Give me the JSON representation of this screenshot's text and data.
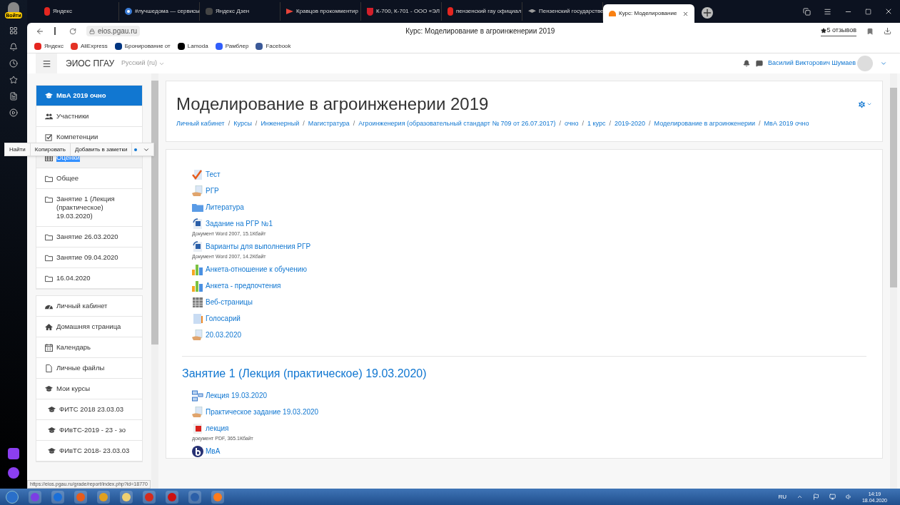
{
  "browser": {
    "login_badge": "Войти",
    "tabs": [
      {
        "title": "Яндекс",
        "selected": false
      },
      {
        "title": "#лучшедома — сервисы",
        "selected": false
      },
      {
        "title": "Яндекс Дзен",
        "selected": false
      },
      {
        "title": "Кравцов прокомментир",
        "selected": false
      },
      {
        "title": "К-700, К-701 - ООО «ЭЛ",
        "selected": false
      },
      {
        "title": "пензенский гау официал",
        "selected": false
      },
      {
        "title": "Пензенский государстве",
        "selected": false
      },
      {
        "title": "Курс: Моделирование",
        "selected": true
      }
    ],
    "address": "eios.pgau.ru",
    "page_title": "Курс: Моделирование в агроинженерии 2019",
    "reviews": "5 отзывов",
    "bookmarks": [
      {
        "label": "Яндекс",
        "color": "#e52620"
      },
      {
        "label": "AliExpress",
        "color": "#e43225"
      },
      {
        "label": "Бронирование от",
        "color": "#003580"
      },
      {
        "label": "Lamoda",
        "color": "#000000"
      },
      {
        "label": "Рамблер",
        "color": "#315efb"
      },
      {
        "label": "Facebook",
        "color": "#3b5998"
      }
    ],
    "status_url": "https://eios.pgau.ru/grade/report/index.php?id=18770"
  },
  "navbar": {
    "site": "ЭИОС ПГАУ",
    "language": "Русский (ru)",
    "user": "Василий Викторович Шумаев"
  },
  "drawer": {
    "groups": [
      {
        "items": [
          {
            "label": "МвА 2019 очно",
            "selected": true,
            "text_selected": false
          },
          {
            "label": "Участники",
            "selected": false,
            "text_selected": false
          },
          {
            "label": "Компетенции",
            "selected": false,
            "text_selected": false
          },
          {
            "label": "Оценки",
            "selected": false,
            "text_selected": true
          },
          {
            "label": "Общее",
            "selected": false,
            "text_selected": false
          },
          {
            "label": "Занятие 1 (Лекция (практическое) 19.03.2020)",
            "selected": false,
            "text_selected": false
          },
          {
            "label": "Занятие 26.03.2020",
            "selected": false,
            "text_selected": false
          },
          {
            "label": "Занятие 09.04.2020",
            "selected": false,
            "text_selected": false
          },
          {
            "label": "16.04.2020",
            "selected": false,
            "text_selected": false
          }
        ]
      },
      {
        "items": [
          {
            "label": "Личный кабинет",
            "selected": false,
            "text_selected": false
          },
          {
            "label": "Домашняя страница",
            "selected": false,
            "text_selected": false
          },
          {
            "label": "Календарь",
            "selected": false,
            "text_selected": false
          },
          {
            "label": "Личные файлы",
            "selected": false,
            "text_selected": false
          },
          {
            "label": "Мои курсы",
            "selected": false,
            "text_selected": false
          },
          {
            "label": "ФИТС 2018 23.03.03",
            "selected": false,
            "text_selected": false
          },
          {
            "label": "ФИвТС-2019 - 23 - зо",
            "selected": false,
            "text_selected": false
          },
          {
            "label": "ФИвТС 2018- 23.03.03",
            "selected": false,
            "text_selected": false
          }
        ]
      }
    ]
  },
  "context_menu": {
    "items": [
      "Найти",
      "Копировать",
      "Добавить в заметки"
    ]
  },
  "course": {
    "title": "Моделирование в агроинженерии 2019",
    "breadcrumbs": [
      {
        "label": "Личный кабинет"
      },
      {
        "separator": "/",
        "label": "Курсы"
      },
      {
        "separator": "/",
        "label": "Инженерный"
      },
      {
        "separator": "/",
        "label": "Магистратура"
      },
      {
        "separator": "/",
        "label": "Агроинженерия (образовательный стандарт № 709 от 26.07.2017)"
      },
      {
        "separator": "/",
        "label": "очно"
      },
      {
        "separator": "/",
        "label": "1 курс"
      },
      {
        "separator": "/",
        "label": "2019-2020"
      },
      {
        "separator": "/",
        "label": "Моделирование в агроинженерии"
      },
      {
        "separator": "/",
        "label": "МвА 2019 очно"
      }
    ]
  },
  "sections": [
    {
      "activities": [
        {
          "name": "Тест",
          "kind": "quiz"
        },
        {
          "name": "РГР",
          "kind": "assign"
        },
        {
          "name": "Литература",
          "kind": "folder"
        },
        {
          "name": "Задание на РГР №1",
          "kind": "word",
          "meta": "Документ Word 2007, 15.1Кбайт"
        },
        {
          "name": "Варианты для выполнения РГР",
          "kind": "word",
          "meta": "Документ Word 2007, 14.2Кбайт"
        },
        {
          "name": "Анкета-отношение к обучению",
          "kind": "feedback"
        },
        {
          "name": "Анкета - предпочтения",
          "kind": "feedback"
        },
        {
          "name": "Веб-страницы",
          "kind": "page"
        },
        {
          "name": "Голосарий",
          "kind": "glossary"
        },
        {
          "name": "20.03.2020",
          "kind": "assign"
        }
      ]
    },
    {
      "title": "Занятие 1 (Лекция (практическое) 19.03.2020)",
      "activities": [
        {
          "name": "Лекция 19.03.2020",
          "kind": "lesson"
        },
        {
          "name": "Практическое задание 19.03.2020",
          "kind": "assign"
        },
        {
          "name": "лекция",
          "kind": "pdf",
          "meta": "документ PDF, 365.1Кбайт"
        },
        {
          "name": "МвА",
          "kind": "bbb"
        }
      ]
    }
  ],
  "taskbar": {
    "language": "RU",
    "time": "14:19",
    "date": "18.04.2020"
  }
}
